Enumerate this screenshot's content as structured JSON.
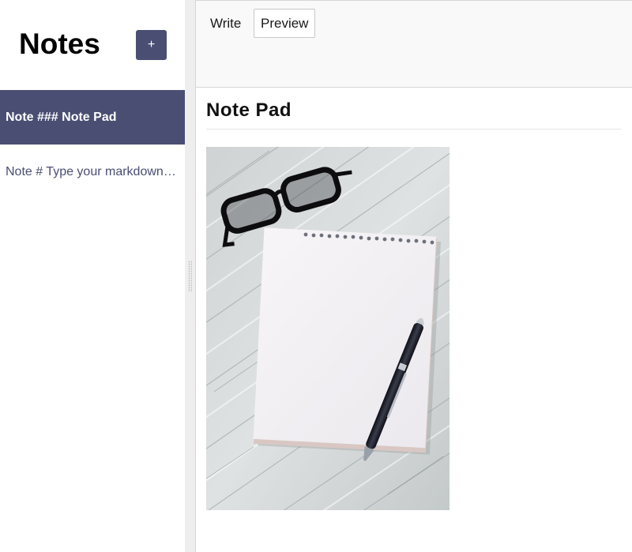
{
  "sidebar": {
    "title": "Notes",
    "add_button_label": "+",
    "notes": [
      {
        "label": "Note ### Note Pad",
        "selected": true
      },
      {
        "label": "Note # Type your markdown note's title here",
        "selected": false
      }
    ]
  },
  "editor": {
    "tabs": [
      {
        "label": "Write",
        "active": false
      },
      {
        "label": "Preview",
        "active": true
      }
    ],
    "preview": {
      "heading": "Note Pad",
      "image": "photo-notepad-pen-glasses"
    }
  },
  "colors": {
    "accent": "#4a4e72",
    "header_bg": "#f9f9f9",
    "gutter_bg": "#eeeeee"
  }
}
